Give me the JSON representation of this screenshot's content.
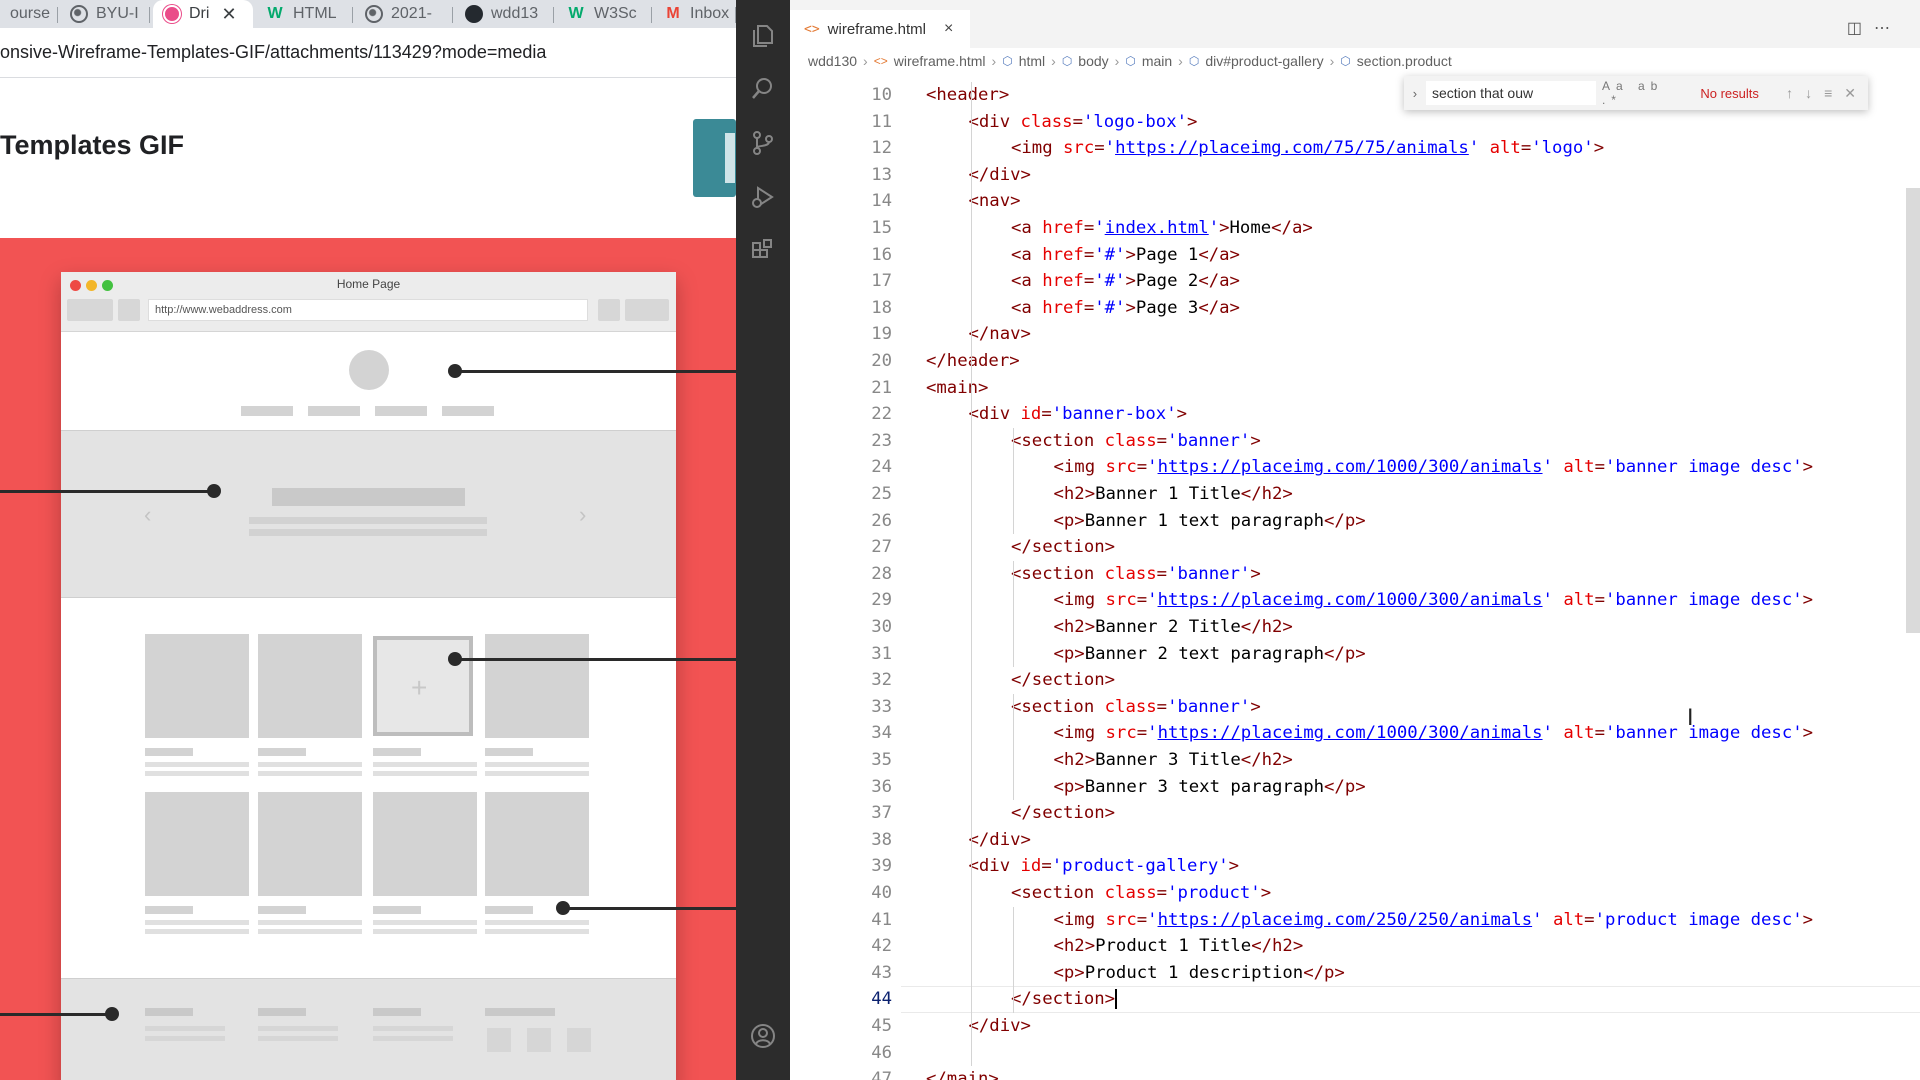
{
  "browser": {
    "tabs": [
      {
        "label": "ourse",
        "icon": "course-icon"
      },
      {
        "label": "BYU-I",
        "icon": "globe-icon"
      },
      {
        "label": "Dri",
        "icon": "dribbble-icon",
        "active": true
      },
      {
        "label": "HTML",
        "icon": "w3schools-icon"
      },
      {
        "label": "2021-",
        "icon": "globe-icon"
      },
      {
        "label": "wdd13",
        "icon": "github-icon"
      },
      {
        "label": "W3Sc",
        "icon": "w3schools-icon"
      },
      {
        "label": "Inbox",
        "icon": "gmail-icon"
      }
    ],
    "url": "onsive-Wireframe-Templates-GIF/attachments/113429?mode=media",
    "page_title": "Templates GIF",
    "mockup": {
      "title": "Home Page",
      "url": "http://www.webaddress.com"
    }
  },
  "vscode": {
    "tab": {
      "label": "wireframe.html",
      "icon": "<>"
    },
    "breadcrumbs": [
      "wdd130",
      "wireframe.html",
      "html",
      "body",
      "main",
      "div#product-gallery",
      "section.product"
    ],
    "find": {
      "query": "section that ouw",
      "result": "No results",
      "options": "Aa ab .*"
    },
    "current_line": 44,
    "lines": [
      {
        "n": 10,
        "indent": 2,
        "tokens": [
          [
            "t",
            "<header>"
          ]
        ]
      },
      {
        "n": 11,
        "indent": 3,
        "tokens": [
          [
            "t",
            "<div "
          ],
          [
            "a",
            "class"
          ],
          [
            "t",
            "="
          ],
          [
            "s",
            "'logo-box'"
          ],
          [
            "t",
            ">"
          ]
        ]
      },
      {
        "n": 12,
        "indent": 4,
        "tokens": [
          [
            "t",
            "<img "
          ],
          [
            "a",
            "src"
          ],
          [
            "t",
            "="
          ],
          [
            "s",
            "'"
          ],
          [
            "l",
            "https://placeimg.com/75/75/animals"
          ],
          [
            "s",
            "'"
          ],
          [
            "x",
            " "
          ],
          [
            "a",
            "alt"
          ],
          [
            "t",
            "="
          ],
          [
            "s",
            "'logo'"
          ],
          [
            "t",
            ">"
          ]
        ]
      },
      {
        "n": 13,
        "indent": 3,
        "tokens": [
          [
            "t",
            "</div>"
          ]
        ]
      },
      {
        "n": 14,
        "indent": 3,
        "tokens": [
          [
            "t",
            "<nav>"
          ]
        ]
      },
      {
        "n": 15,
        "indent": 4,
        "tokens": [
          [
            "t",
            "<a "
          ],
          [
            "a",
            "href"
          ],
          [
            "t",
            "="
          ],
          [
            "s",
            "'"
          ],
          [
            "l",
            "index.html"
          ],
          [
            "s",
            "'"
          ],
          [
            "t",
            ">"
          ],
          [
            "x",
            "Home"
          ],
          [
            "t",
            "</a>"
          ]
        ]
      },
      {
        "n": 16,
        "indent": 4,
        "tokens": [
          [
            "t",
            "<a "
          ],
          [
            "a",
            "href"
          ],
          [
            "t",
            "="
          ],
          [
            "s",
            "'#'"
          ],
          [
            "t",
            ">"
          ],
          [
            "x",
            "Page 1"
          ],
          [
            "t",
            "</a>"
          ]
        ]
      },
      {
        "n": 17,
        "indent": 4,
        "tokens": [
          [
            "t",
            "<a "
          ],
          [
            "a",
            "href"
          ],
          [
            "t",
            "="
          ],
          [
            "s",
            "'#'"
          ],
          [
            "t",
            ">"
          ],
          [
            "x",
            "Page 2"
          ],
          [
            "t",
            "</a>"
          ]
        ]
      },
      {
        "n": 18,
        "indent": 4,
        "tokens": [
          [
            "t",
            "<a "
          ],
          [
            "a",
            "href"
          ],
          [
            "t",
            "="
          ],
          [
            "s",
            "'#'"
          ],
          [
            "t",
            ">"
          ],
          [
            "x",
            "Page 3"
          ],
          [
            "t",
            "</a>"
          ]
        ]
      },
      {
        "n": 19,
        "indent": 3,
        "tokens": [
          [
            "t",
            "</nav>"
          ]
        ]
      },
      {
        "n": 20,
        "indent": 2,
        "tokens": [
          [
            "t",
            "</header>"
          ]
        ]
      },
      {
        "n": 21,
        "indent": 2,
        "tokens": [
          [
            "t",
            "<main>"
          ]
        ]
      },
      {
        "n": 22,
        "indent": 3,
        "tokens": [
          [
            "t",
            "<div "
          ],
          [
            "a",
            "id"
          ],
          [
            "t",
            "="
          ],
          [
            "s",
            "'banner-box'"
          ],
          [
            "t",
            ">"
          ]
        ]
      },
      {
        "n": 23,
        "indent": 4,
        "tokens": [
          [
            "t",
            "<section "
          ],
          [
            "a",
            "class"
          ],
          [
            "t",
            "="
          ],
          [
            "s",
            "'banner'"
          ],
          [
            "t",
            ">"
          ]
        ]
      },
      {
        "n": 24,
        "indent": 5,
        "tokens": [
          [
            "t",
            "<img "
          ],
          [
            "a",
            "src"
          ],
          [
            "t",
            "="
          ],
          [
            "s",
            "'"
          ],
          [
            "l",
            "https://placeimg.com/1000/300/animals"
          ],
          [
            "s",
            "'"
          ],
          [
            "x",
            " "
          ],
          [
            "a",
            "alt"
          ],
          [
            "t",
            "="
          ],
          [
            "s",
            "'banner image desc'"
          ],
          [
            "t",
            ">"
          ]
        ]
      },
      {
        "n": 25,
        "indent": 5,
        "tokens": [
          [
            "t",
            "<h2>"
          ],
          [
            "x",
            "Banner 1 Title"
          ],
          [
            "t",
            "</h2>"
          ]
        ]
      },
      {
        "n": 26,
        "indent": 5,
        "tokens": [
          [
            "t",
            "<p>"
          ],
          [
            "x",
            "Banner 1 text paragraph"
          ],
          [
            "t",
            "</p>"
          ]
        ]
      },
      {
        "n": 27,
        "indent": 4,
        "tokens": [
          [
            "t",
            "</section>"
          ]
        ]
      },
      {
        "n": 28,
        "indent": 4,
        "tokens": [
          [
            "t",
            "<section "
          ],
          [
            "a",
            "class"
          ],
          [
            "t",
            "="
          ],
          [
            "s",
            "'banner'"
          ],
          [
            "t",
            ">"
          ]
        ]
      },
      {
        "n": 29,
        "indent": 5,
        "tokens": [
          [
            "t",
            "<img "
          ],
          [
            "a",
            "src"
          ],
          [
            "t",
            "="
          ],
          [
            "s",
            "'"
          ],
          [
            "l",
            "https://placeimg.com/1000/300/animals"
          ],
          [
            "s",
            "'"
          ],
          [
            "x",
            " "
          ],
          [
            "a",
            "alt"
          ],
          [
            "t",
            "="
          ],
          [
            "s",
            "'banner image desc'"
          ],
          [
            "t",
            ">"
          ]
        ]
      },
      {
        "n": 30,
        "indent": 5,
        "tokens": [
          [
            "t",
            "<h2>"
          ],
          [
            "x",
            "Banner 2 Title"
          ],
          [
            "t",
            "</h2>"
          ]
        ]
      },
      {
        "n": 31,
        "indent": 5,
        "tokens": [
          [
            "t",
            "<p>"
          ],
          [
            "x",
            "Banner 2 text paragraph"
          ],
          [
            "t",
            "</p>"
          ]
        ]
      },
      {
        "n": 32,
        "indent": 4,
        "tokens": [
          [
            "t",
            "</section>"
          ]
        ]
      },
      {
        "n": 33,
        "indent": 4,
        "tokens": [
          [
            "t",
            "<section "
          ],
          [
            "a",
            "class"
          ],
          [
            "t",
            "="
          ],
          [
            "s",
            "'banner'"
          ],
          [
            "t",
            ">"
          ]
        ]
      },
      {
        "n": 34,
        "indent": 5,
        "tokens": [
          [
            "t",
            "<img "
          ],
          [
            "a",
            "src"
          ],
          [
            "t",
            "="
          ],
          [
            "s",
            "'"
          ],
          [
            "l",
            "https://placeimg.com/1000/300/animals"
          ],
          [
            "s",
            "'"
          ],
          [
            "x",
            " "
          ],
          [
            "a",
            "alt"
          ],
          [
            "t",
            "="
          ],
          [
            "s",
            "'banner image desc'"
          ],
          [
            "t",
            ">"
          ]
        ]
      },
      {
        "n": 35,
        "indent": 5,
        "tokens": [
          [
            "t",
            "<h2>"
          ],
          [
            "x",
            "Banner 3 Title"
          ],
          [
            "t",
            "</h2>"
          ]
        ]
      },
      {
        "n": 36,
        "indent": 5,
        "tokens": [
          [
            "t",
            "<p>"
          ],
          [
            "x",
            "Banner 3 text paragraph"
          ],
          [
            "t",
            "</p>"
          ]
        ]
      },
      {
        "n": 37,
        "indent": 4,
        "tokens": [
          [
            "t",
            "</section>"
          ]
        ]
      },
      {
        "n": 38,
        "indent": 3,
        "tokens": [
          [
            "t",
            "</div>"
          ]
        ]
      },
      {
        "n": 39,
        "indent": 3,
        "tokens": [
          [
            "t",
            "<div "
          ],
          [
            "a",
            "id"
          ],
          [
            "t",
            "="
          ],
          [
            "s",
            "'product-gallery'"
          ],
          [
            "t",
            ">"
          ]
        ]
      },
      {
        "n": 40,
        "indent": 4,
        "tokens": [
          [
            "t",
            "<section "
          ],
          [
            "a",
            "class"
          ],
          [
            "t",
            "="
          ],
          [
            "s",
            "'product'"
          ],
          [
            "t",
            ">"
          ]
        ]
      },
      {
        "n": 41,
        "indent": 5,
        "tokens": [
          [
            "t",
            "<img "
          ],
          [
            "a",
            "src"
          ],
          [
            "t",
            "="
          ],
          [
            "s",
            "'"
          ],
          [
            "l",
            "https://placeimg.com/250/250/animals"
          ],
          [
            "s",
            "'"
          ],
          [
            "x",
            " "
          ],
          [
            "a",
            "alt"
          ],
          [
            "t",
            "="
          ],
          [
            "s",
            "'product image desc'"
          ],
          [
            "t",
            ">"
          ]
        ]
      },
      {
        "n": 42,
        "indent": 5,
        "tokens": [
          [
            "t",
            "<h2>"
          ],
          [
            "x",
            "Product 1 Title"
          ],
          [
            "t",
            "</h2>"
          ]
        ]
      },
      {
        "n": 43,
        "indent": 5,
        "tokens": [
          [
            "t",
            "<p>"
          ],
          [
            "x",
            "Product 1 description"
          ],
          [
            "t",
            "</p>"
          ]
        ]
      },
      {
        "n": 44,
        "indent": 4,
        "tokens": [
          [
            "t",
            "</section>"
          ]
        ]
      },
      {
        "n": 45,
        "indent": 3,
        "tokens": [
          [
            "t",
            "</div>"
          ]
        ]
      },
      {
        "n": 46,
        "indent": 0,
        "tokens": []
      },
      {
        "n": 47,
        "indent": 2,
        "tokens": [
          [
            "t",
            "</main>"
          ]
        ]
      }
    ]
  },
  "colors": {
    "tag": "#800000",
    "attr": "#e50000",
    "string": "#0000ff",
    "activity_bar": "#2c2c2c",
    "gif_background": "#f25353"
  }
}
